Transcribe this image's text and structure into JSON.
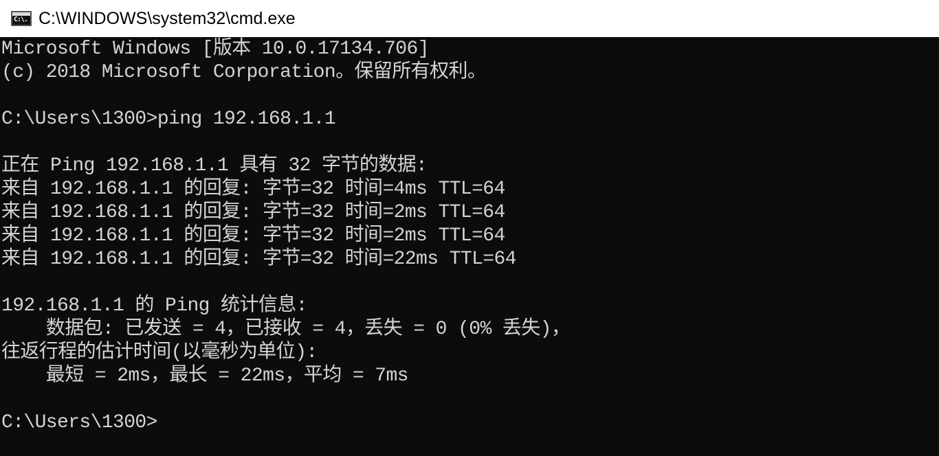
{
  "window": {
    "title": "C:\\WINDOWS\\system32\\cmd.exe",
    "icon": "cmd-icon",
    "icon_glyph": "C:\\."
  },
  "console": {
    "lines": [
      "Microsoft Windows [版本 10.0.17134.706]",
      "(c) 2018 Microsoft Corporation。保留所有权利。",
      "",
      "C:\\Users\\1300>ping 192.168.1.1",
      "",
      "正在 Ping 192.168.1.1 具有 32 字节的数据:",
      "来自 192.168.1.1 的回复: 字节=32 时间=4ms TTL=64",
      "来自 192.168.1.1 的回复: 字节=32 时间=2ms TTL=64",
      "来自 192.168.1.1 的回复: 字节=32 时间=2ms TTL=64",
      "来自 192.168.1.1 的回复: 字节=32 时间=22ms TTL=64",
      "",
      "192.168.1.1 的 Ping 统计信息:",
      "    数据包: 已发送 = 4，已接收 = 4，丢失 = 0 (0% 丢失)，",
      "往返行程的估计时间(以毫秒为单位):",
      "    最短 = 2ms，最长 = 22ms，平均 = 7ms",
      "",
      "C:\\Users\\1300>"
    ]
  },
  "colors": {
    "background": "#0c0c0c",
    "foreground": "#d4d4d4",
    "titlebar": "#ffffff"
  }
}
